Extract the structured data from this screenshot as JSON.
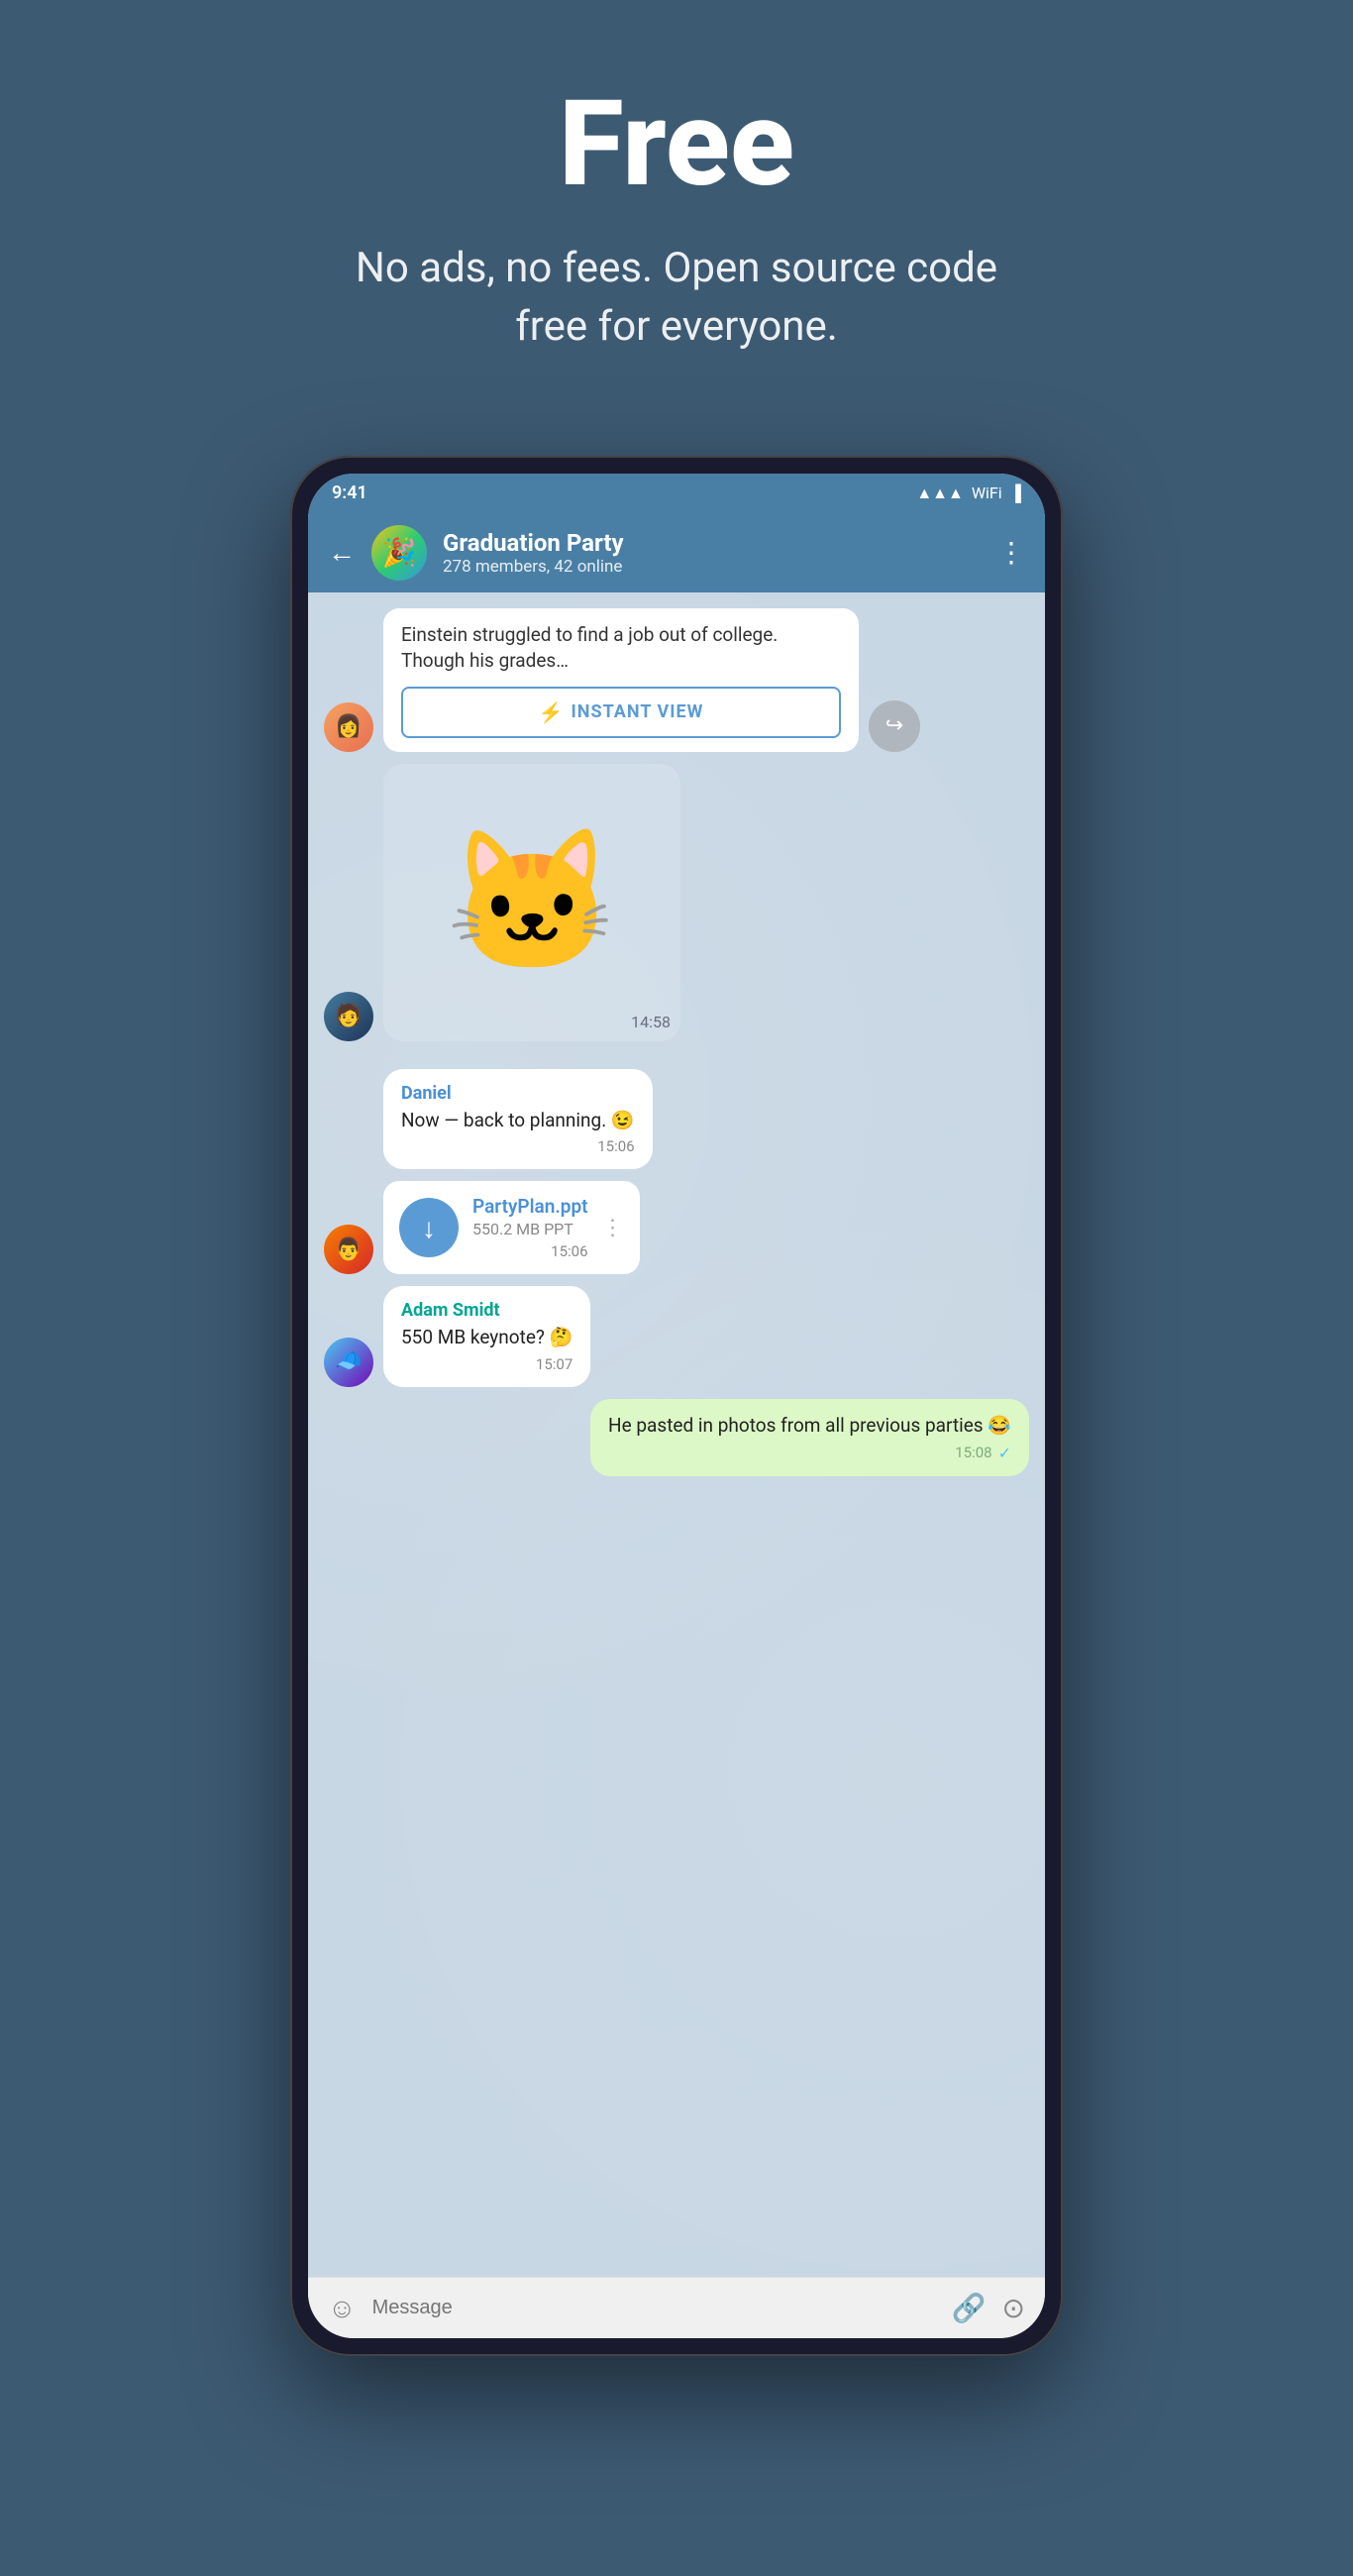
{
  "hero": {
    "title": "Free",
    "subtitle": "No ads, no fees. Open source code free for everyone."
  },
  "phone": {
    "statusBar": {
      "time": "9:41",
      "icons": [
        "●●●",
        "WiFi",
        "Battery"
      ]
    },
    "header": {
      "backLabel": "←",
      "groupName": "Graduation Party",
      "groupMeta": "278 members, 42 online",
      "menuIcon": "⋮"
    },
    "messages": [
      {
        "type": "article",
        "text": "Einstein struggled to find a job out of college. Though his grades…",
        "instantViewLabel": "INSTANT VIEW"
      },
      {
        "type": "sticker",
        "time": "14:58"
      },
      {
        "type": "text",
        "sender": "Daniel",
        "senderColor": "blue",
        "text": "Now — back to planning. 😉",
        "time": "15:06"
      },
      {
        "type": "file",
        "fileName": "PartyPlan.ppt",
        "fileSize": "550.2 MB PPT",
        "time": "15:06"
      },
      {
        "type": "text",
        "sender": "Adam Smidt",
        "senderColor": "teal",
        "text": "550 MB keynote? 🤔",
        "time": "15:07"
      },
      {
        "type": "outgoing",
        "text": "He pasted in photos from all previous parties 😂",
        "time": "15:08",
        "checked": true
      }
    ],
    "messageBar": {
      "placeholder": "Message",
      "emojiIcon": "☺",
      "attachIcon": "🖇",
      "cameraIcon": "⊙"
    }
  }
}
